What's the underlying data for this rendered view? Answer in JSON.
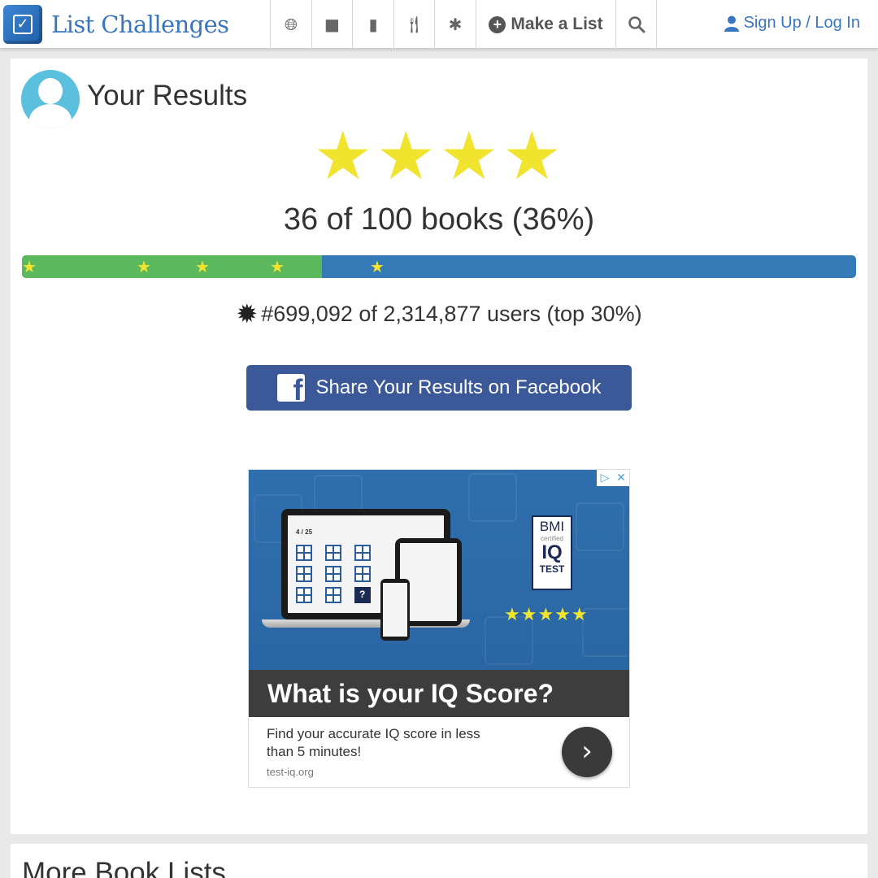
{
  "nav": {
    "brand": "List Challenges",
    "icons": [
      "globe-icon",
      "video-camera-icon",
      "book-icon",
      "fork-knife-icon",
      "asterisk-icon"
    ],
    "make_list_label": "Make a List",
    "search_icon": "search-icon",
    "signup_label": "Sign Up / Log In"
  },
  "results": {
    "title": "Your Results",
    "rating_stars": 4,
    "count_text": "36 of 100 books (36%)",
    "progress_fraction": 0.36,
    "rank_text": "#699,092 of 2,314,877 users (top 30%)",
    "share_label": "Share Your Results on Facebook"
  },
  "ad": {
    "question_counter": "4 / 25",
    "badge_line1": "BMI",
    "badge_line2": "certified",
    "badge_line3": "IQ",
    "badge_line4": "TEST",
    "rating_stars": 5,
    "headline": "What is your IQ Score?",
    "description": "Find your accurate IQ score in less than 5 minutes!",
    "url": "test-iq.org"
  },
  "more": {
    "heading": "More Book Lists"
  },
  "colors": {
    "brand_blue": "#3a75bf",
    "progress_done": "#5cb85c",
    "progress_remaining": "#337ab7",
    "star_yellow": "#f0e42f",
    "facebook_blue": "#3b5998",
    "avatar": "#5bc0de"
  }
}
